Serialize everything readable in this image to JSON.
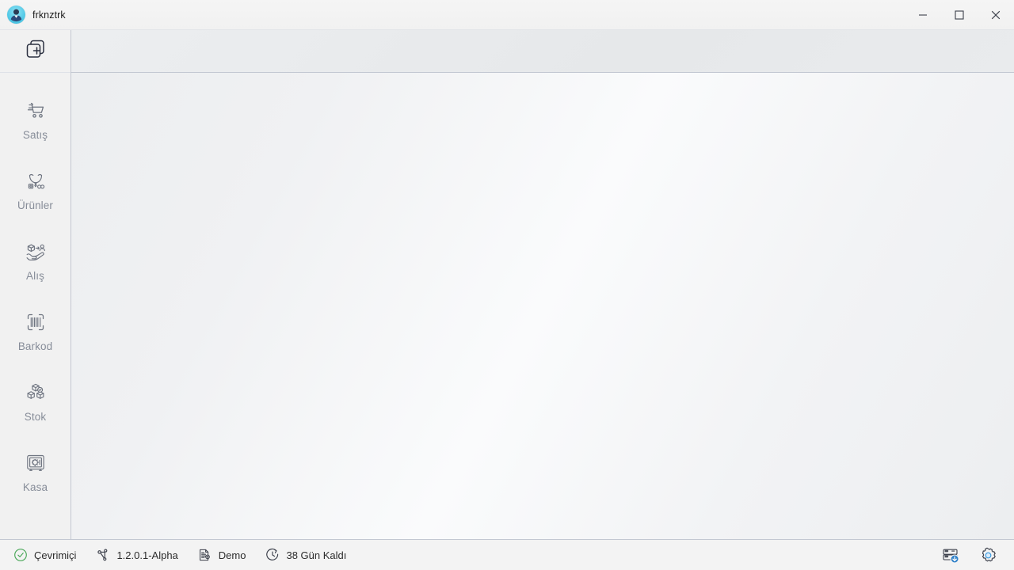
{
  "window": {
    "title": "frknztrk",
    "avatar_icon": "user-avatar-icon",
    "controls": {
      "minimize": "minimize-icon",
      "maximize": "maximize-icon",
      "close": "close-icon"
    }
  },
  "sidebar": {
    "new_tab": {
      "icon": "new-tab-plus-icon",
      "label": ""
    },
    "items": [
      {
        "label": "Satış",
        "icon": "shopping-cart-icon"
      },
      {
        "label": "Ürünler",
        "icon": "jewelry-necklace-icon"
      },
      {
        "label": "Alış",
        "icon": "purchase-handover-icon"
      },
      {
        "label": "Barkod",
        "icon": "barcode-scan-icon"
      },
      {
        "label": "Stok",
        "icon": "stacked-boxes-check-icon"
      },
      {
        "label": "Kasa",
        "icon": "safe-vault-icon"
      }
    ]
  },
  "content": {
    "tabs": [],
    "empty": ""
  },
  "statusbar": {
    "items": [
      {
        "label": "Çevrimiçi",
        "icon": "check-circle-icon"
      },
      {
        "label": "1.2.0.1-Alpha",
        "icon": "git-branch-icon"
      },
      {
        "label": "Demo",
        "icon": "document-license-icon"
      },
      {
        "label": "38 Gün Kaldı",
        "icon": "clock-countdown-icon"
      }
    ],
    "right": [
      {
        "icon": "server-download-icon"
      },
      {
        "icon": "settings-gear-icon"
      }
    ]
  },
  "colors": {
    "accent_blue": "#2f80c8",
    "avatar_cyan": "#56cbe8",
    "online_green": "#4aa758",
    "sidebar_label": "#878d99",
    "icon_gray": "#6e7480",
    "border": "#c3c8d2"
  }
}
